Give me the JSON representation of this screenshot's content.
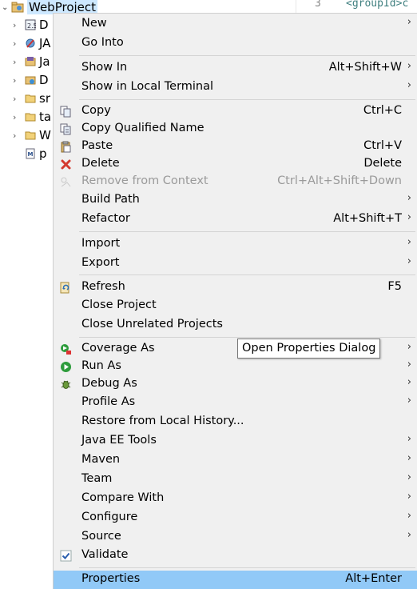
{
  "explorer": {
    "project_name": "WebProject",
    "items": [
      {
        "label": "D",
        "icon": "deployment-descriptor-icon"
      },
      {
        "label": "JA",
        "icon": "jax-ws-icon"
      },
      {
        "label": "Ja",
        "icon": "java-resources-icon"
      },
      {
        "label": "D",
        "icon": "deployed-resources-icon"
      },
      {
        "label": "sr",
        "icon": "folder-icon"
      },
      {
        "label": "ta",
        "icon": "folder-icon"
      },
      {
        "label": "W",
        "icon": "folder-icon"
      },
      {
        "label": "p",
        "icon": "maven-pom-icon"
      }
    ]
  },
  "editor": {
    "line_number": "3",
    "code": "<groupId>c"
  },
  "menu": {
    "items": [
      {
        "label": "New",
        "accel": "",
        "submenu": true
      },
      {
        "label": "Go Into",
        "accel": ""
      },
      {
        "label": "Show In",
        "accel": "Alt+Shift+W",
        "submenu": true
      },
      {
        "label": "Show in Local Terminal",
        "accel": "",
        "submenu": true
      },
      {
        "label": "Copy",
        "accel": "Ctrl+C"
      },
      {
        "label": "Copy Qualified Name",
        "accel": ""
      },
      {
        "label": "Paste",
        "accel": "Ctrl+V"
      },
      {
        "label": "Delete",
        "accel": "Delete"
      },
      {
        "label": "Remove from Context",
        "accel": "Ctrl+Alt+Shift+Down",
        "disabled": true
      },
      {
        "label": "Build Path",
        "accel": "",
        "submenu": true
      },
      {
        "label": "Refactor",
        "accel": "Alt+Shift+T",
        "submenu": true
      },
      {
        "label": "Import",
        "accel": "",
        "submenu": true
      },
      {
        "label": "Export",
        "accel": "",
        "submenu": true
      },
      {
        "label": "Refresh",
        "accel": "F5"
      },
      {
        "label": "Close Project",
        "accel": ""
      },
      {
        "label": "Close Unrelated Projects",
        "accel": ""
      },
      {
        "label": "Coverage As",
        "accel": "",
        "submenu": true
      },
      {
        "label": "Run As",
        "accel": "",
        "submenu": true
      },
      {
        "label": "Debug As",
        "accel": "",
        "submenu": true
      },
      {
        "label": "Profile As",
        "accel": "",
        "submenu": true
      },
      {
        "label": "Restore from Local History...",
        "accel": ""
      },
      {
        "label": "Java EE Tools",
        "accel": "",
        "submenu": true
      },
      {
        "label": "Maven",
        "accel": "",
        "submenu": true
      },
      {
        "label": "Team",
        "accel": "",
        "submenu": true
      },
      {
        "label": "Compare With",
        "accel": "",
        "submenu": true
      },
      {
        "label": "Configure",
        "accel": "",
        "submenu": true
      },
      {
        "label": "Source",
        "accel": "",
        "submenu": true
      },
      {
        "label": "Validate",
        "accel": ""
      },
      {
        "label": "Properties",
        "accel": "Alt+Enter",
        "highlighted": true
      }
    ]
  },
  "tooltip": {
    "text": "Open Properties Dialog"
  },
  "colors": {
    "menu_bg": "#f0f0f0",
    "highlight": "#91c9f7",
    "disabled_text": "#9a9a9a",
    "selection_bg": "#cde8ff"
  }
}
